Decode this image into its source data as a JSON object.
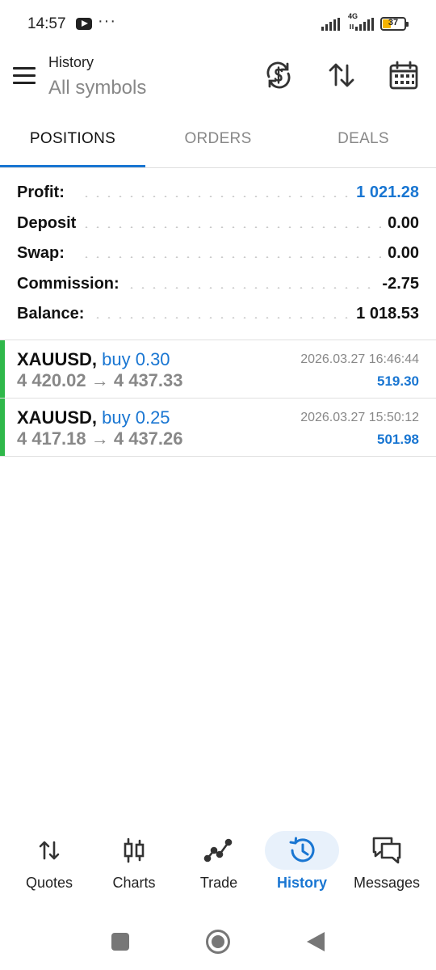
{
  "status_bar": {
    "time": "14:57",
    "notification_dots": "···",
    "network_label": "4G",
    "battery": "37",
    "battery_level": 0.37
  },
  "header": {
    "title": "History",
    "subtitle": "All symbols",
    "icons": [
      "menu-icon",
      "currency-exchange-icon",
      "sort-arrows-icon",
      "calendar-icon"
    ]
  },
  "tabs": [
    {
      "label": "POSITIONS",
      "active": true
    },
    {
      "label": "ORDERS",
      "active": false
    },
    {
      "label": "DEALS",
      "active": false
    }
  ],
  "summary": {
    "profit": {
      "label": "Profit:",
      "value": "1 021.28"
    },
    "deposit": {
      "label": "Deposit",
      "value": "0.00"
    },
    "swap": {
      "label": "Swap:",
      "value": "0.00"
    },
    "commission": {
      "label": "Commission:",
      "value": "-2.75"
    },
    "balance": {
      "label": "Balance:",
      "value": "1 018.53"
    }
  },
  "positions": [
    {
      "symbol": "XAUUSD,",
      "type": "buy 0.30",
      "prices": "4 420.02 → 4 437.33",
      "time": "2026.03.27 16:46:44",
      "profit": "519.30"
    },
    {
      "symbol": "XAUUSD,",
      "type": "buy 0.25",
      "prices": "4 417.18 → 4 437.26",
      "time": "2026.03.27 15:50:12",
      "profit": "501.98"
    }
  ],
  "bottom_nav": [
    {
      "label": "Quotes",
      "icon": "quotes-arrows-icon",
      "active": false
    },
    {
      "label": "Charts",
      "icon": "candlestick-icon",
      "active": false
    },
    {
      "label": "Trade",
      "icon": "trade-line-icon",
      "active": false
    },
    {
      "label": "History",
      "icon": "history-clock-icon",
      "active": true
    },
    {
      "label": "Messages",
      "icon": "messages-icon",
      "active": false
    }
  ],
  "colors": {
    "accent": "#1976d2",
    "profit_bar": "#2fb84a",
    "muted": "#888888",
    "nav_pill": "#e8f1fb"
  }
}
